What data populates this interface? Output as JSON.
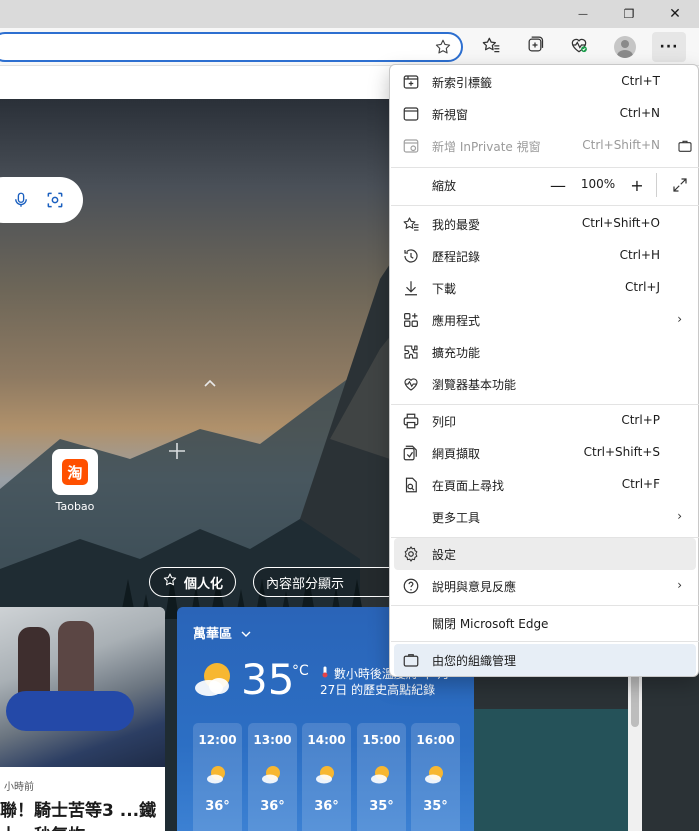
{
  "window": {
    "minimize_glyph": "—",
    "restore_glyph": "❐",
    "close_glyph": "✕"
  },
  "toolbar": {
    "icons": [
      "star-icon",
      "favorites-icon",
      "collections-icon",
      "browser-essentials-icon",
      "profile-avatar",
      "more-icon"
    ],
    "more_glyph": "···"
  },
  "newtab": {
    "tile_label": "Taobao",
    "tile_logo_text": "淘",
    "personalize_label": "個人化",
    "content_label": "內容部分顯示"
  },
  "news": {
    "meta": "小時前",
    "title": "聯！騎士苦等3 ...鐵十一秒氣炸"
  },
  "weather": {
    "location": "萬華區",
    "temperature": "35",
    "unit": "°C",
    "alert": "數小時後溫度將 下 月27日 的歷史高點紀錄",
    "hours": [
      {
        "time": "12:00",
        "temp": "36°"
      },
      {
        "time": "13:00",
        "temp": "36°"
      },
      {
        "time": "14:00",
        "temp": "36°"
      },
      {
        "time": "15:00",
        "temp": "35°"
      },
      {
        "time": "16:00",
        "temp": "35°"
      }
    ]
  },
  "menu": {
    "new_tab": {
      "label": "新索引標籤",
      "shortcut": "Ctrl+T"
    },
    "new_window": {
      "label": "新視窗",
      "shortcut": "Ctrl+N"
    },
    "new_private": {
      "label": "新增 InPrivate 視窗",
      "shortcut": "Ctrl+Shift+N"
    },
    "zoom": {
      "label": "縮放",
      "value": "100%",
      "minus": "—",
      "plus": "+"
    },
    "favorites": {
      "label": "我的最愛",
      "shortcut": "Ctrl+Shift+O"
    },
    "history": {
      "label": "歷程記錄",
      "shortcut": "Ctrl+H"
    },
    "downloads": {
      "label": "下載",
      "shortcut": "Ctrl+J"
    },
    "apps": {
      "label": "應用程式",
      "arrow": "›"
    },
    "extensions": {
      "label": "擴充功能"
    },
    "essentials": {
      "label": "瀏覽器基本功能"
    },
    "print": {
      "label": "列印",
      "shortcut": "Ctrl+P"
    },
    "capture": {
      "label": "網頁擷取",
      "shortcut": "Ctrl+Shift+S"
    },
    "find": {
      "label": "在頁面上尋找",
      "shortcut": "Ctrl+F"
    },
    "more_tools": {
      "label": "更多工具",
      "arrow": "›"
    },
    "settings": {
      "label": "設定"
    },
    "help": {
      "label": "說明與意見反應",
      "arrow": "›"
    },
    "close_edge": {
      "label": "關閉 Microsoft Edge"
    },
    "managed": {
      "label": "由您的組織管理"
    }
  },
  "colors": {
    "accent": "#2d6fd0",
    "weather_bg": "#2a64b8",
    "taobao": "#ff5000"
  }
}
